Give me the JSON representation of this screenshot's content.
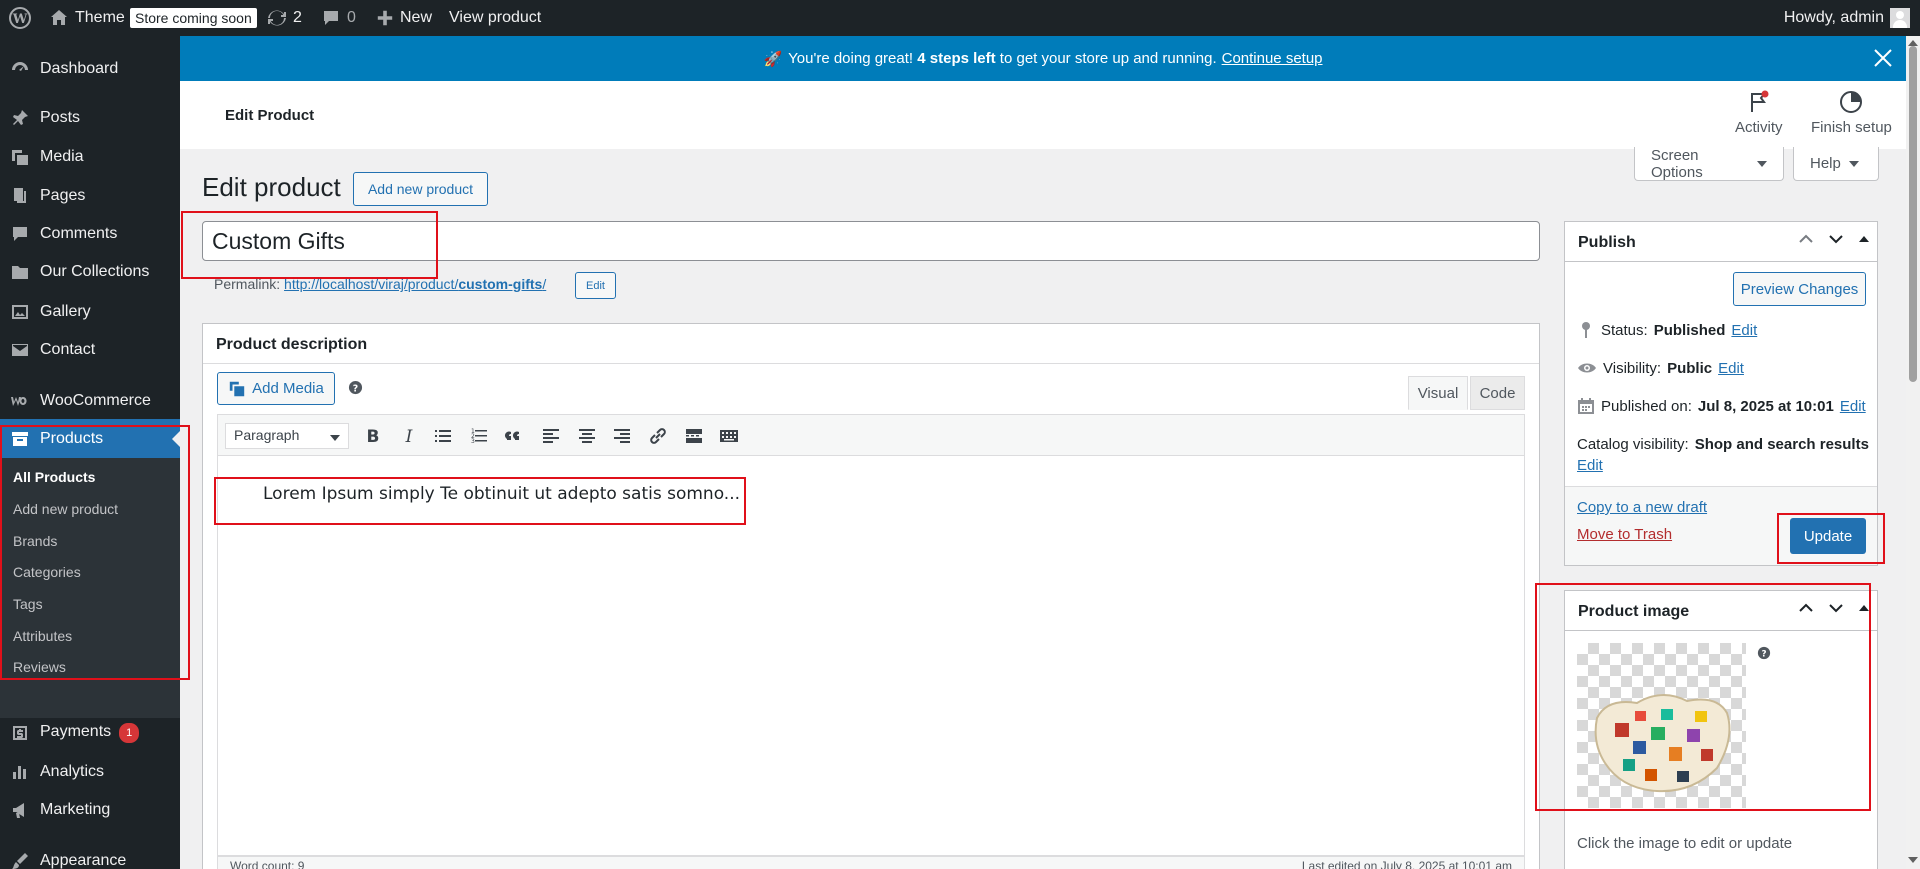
{
  "admin_bar": {
    "site_name": "Theme",
    "store_badge": "Store coming soon",
    "updates_count": "2",
    "comments_count": "0",
    "new_label": "New",
    "view_label": "View product",
    "howdy": "Howdy, admin"
  },
  "sidebar": {
    "items": [
      {
        "label": "Dashboard",
        "icon": "dashboard-icon"
      },
      {
        "label": "Posts",
        "icon": "pin-icon"
      },
      {
        "label": "Media",
        "icon": "media-icon"
      },
      {
        "label": "Pages",
        "icon": "pages-icon"
      },
      {
        "label": "Comments",
        "icon": "comment-icon"
      },
      {
        "label": "Our Collections",
        "icon": "folder-icon"
      },
      {
        "label": "Gallery",
        "icon": "gallery-icon"
      },
      {
        "label": "Contact",
        "icon": "mail-icon"
      },
      {
        "label": "WooCommerce",
        "icon": "woocommerce-icon"
      },
      {
        "label": "Products",
        "icon": "archive-icon"
      },
      {
        "label": "Payments",
        "icon": "payments-icon",
        "badge": "1"
      },
      {
        "label": "Analytics",
        "icon": "chart-icon"
      },
      {
        "label": "Marketing",
        "icon": "megaphone-icon"
      },
      {
        "label": "Appearance",
        "icon": "brush-icon"
      }
    ],
    "submenu": [
      "All Products",
      "Add new product",
      "Brands",
      "Categories",
      "Tags",
      "Attributes",
      "Reviews"
    ]
  },
  "banner": {
    "emoji": "🚀",
    "text_before": "You're doing great!",
    "bold": "4 steps left",
    "text_after": "to get your store up and running.",
    "link": "Continue setup"
  },
  "wc_header": {
    "title": "Edit Product",
    "activity": "Activity",
    "finish_setup": "Finish setup"
  },
  "screen_options": "Screen Options",
  "help": "Help",
  "page": {
    "heading": "Edit product",
    "add_new": "Add new product",
    "title_value": "Custom Gifts",
    "permalink_label": "Permalink:",
    "permalink_base": "http://localhost/viraj/product/",
    "permalink_slug": "custom-gifts",
    "permalink_end": "/",
    "edit": "Edit"
  },
  "description": {
    "title": "Product description",
    "add_media": "Add Media",
    "tab_visual": "Visual",
    "tab_code": "Code",
    "format": "Paragraph",
    "content": "Lorem Ipsum simply Te obtinuit ut adepto satis somno...",
    "word_count": "Word count: 9",
    "last_edited": "Last edited on July 8, 2025 at 10:01 am"
  },
  "publish": {
    "title": "Publish",
    "preview": "Preview Changes",
    "status_label": "Status:",
    "status_value": "Published",
    "visibility_label": "Visibility:",
    "visibility_value": "Public",
    "published_label": "Published on:",
    "published_value": "Jul 8, 2025 at 10:01",
    "catalog_label": "Catalog visibility:",
    "catalog_value": "Shop and search results",
    "edit": "Edit",
    "copy": "Copy to a new draft",
    "trash": "Move to Trash",
    "update": "Update"
  },
  "product_image": {
    "title": "Product image",
    "hint": "Click the image to edit or update"
  },
  "colors": {
    "accent": "#2271b1",
    "banner": "#007cba",
    "sidebar": "#1d2327",
    "highlight": "#e0101a",
    "trash": "#b32d2e"
  }
}
